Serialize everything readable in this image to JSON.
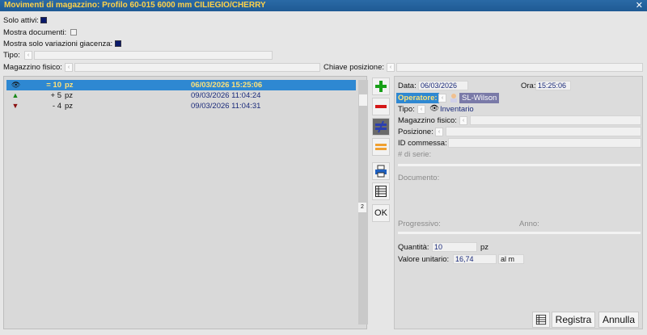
{
  "window": {
    "title": "Movimenti di magazzino: Profilo 60-015 6000 mm CILIEGIO/CHERRY",
    "close": "✕"
  },
  "filters": {
    "solo_attivi": "Solo attivi:",
    "mostra_documenti": "Mostra documenti:",
    "mostra_variazioni": "Mostra solo variazioni giacenza:",
    "tipo": "Tipo:",
    "magazzino_fisico": "Magazzino fisico:",
    "chiave_posizione": "Chiave posizione:"
  },
  "movements": [
    {
      "icon": "eye-icon",
      "glyph": "👁",
      "color": "#111111",
      "qty": "= 10",
      "unit": "pz",
      "datetime": "06/03/2026 15:25:06",
      "selected": true
    },
    {
      "icon": "arrow-up-icon",
      "glyph": "▲",
      "color": "#1a8a1a",
      "qty": "+ 5",
      "unit": "pz",
      "datetime": "09/03/2026 11:04:24",
      "selected": false
    },
    {
      "icon": "arrow-down-icon",
      "glyph": "▼",
      "color": "#8a1010",
      "qty": "- 4",
      "unit": "pz",
      "datetime": "09/03/2026 11:04:31",
      "selected": false
    }
  ],
  "scroll_marker": "2",
  "toolbar": {
    "ok_label": "OK"
  },
  "detail": {
    "data_label": "Data:",
    "data_value": "06/03/2026",
    "ora_label": "Ora:",
    "ora_value": "15:25:06",
    "operatore_label": "Operatore:",
    "operatore_value": "SL-Wilson",
    "tipo_label": "Tipo:",
    "tipo_value": "Inventario",
    "magazzino_label": "Magazzino fisico:",
    "posizione_label": "Posizione:",
    "commessa_label": "ID commessa:",
    "serie_label": "# di serie:",
    "documento_label": "Documento:",
    "progressivo_label": "Progressivo:",
    "anno_label": "Anno:",
    "quantita_label": "Quantità:",
    "quantita_value": "10",
    "quantita_unit": "pz",
    "valore_label": "Valore unitario:",
    "valore_value": "16,74",
    "valore_unit": "al m"
  },
  "actions": {
    "registra": "Registra",
    "annulla": "Annulla"
  }
}
